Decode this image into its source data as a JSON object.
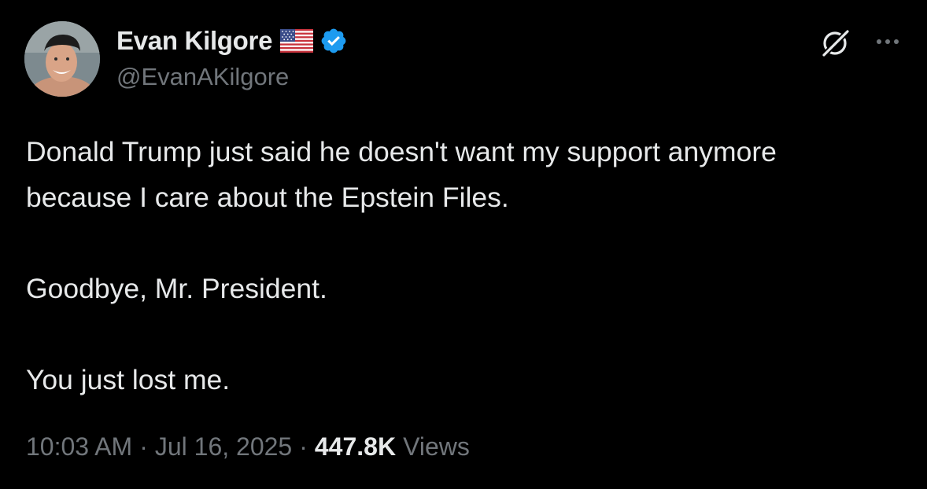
{
  "author": {
    "display_name": "Evan Kilgore",
    "handle": "@EvanAKilgore",
    "flag_icon": "us-flag-icon",
    "verified_badge": "verified-badge-icon",
    "verified_color": "#1d9bf0"
  },
  "header_actions": {
    "grok_icon": "grok-icon",
    "more_icon": "more-icon"
  },
  "tweet": {
    "lines": [
      "Donald Trump just said he doesn't want my support anymore",
      "because I care about the Epstein Files.",
      "Goodbye, Mr. President.",
      "You just lost me."
    ]
  },
  "meta": {
    "time": "10:03 AM",
    "separator": "·",
    "date": "Jul 16, 2025",
    "views_count": "447.8K",
    "views_label": "Views"
  },
  "colors": {
    "background": "#000000",
    "primary_text": "#e7e9ea",
    "secondary_text": "#71767b"
  }
}
